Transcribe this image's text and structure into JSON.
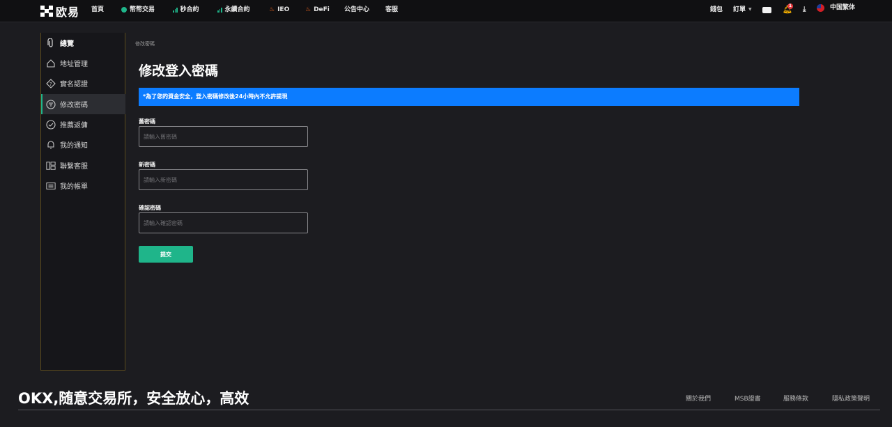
{
  "brand": {
    "logo_text": "欧易"
  },
  "nav": {
    "items": [
      {
        "label": "首頁"
      },
      {
        "label": "幣幣交易"
      },
      {
        "label": "秒合約"
      },
      {
        "label": "永續合約"
      },
      {
        "label": "IEO"
      },
      {
        "label": "DeFi"
      },
      {
        "label": "公告中心"
      },
      {
        "label": "客服"
      }
    ],
    "wallet": "錢包",
    "orders": "訂單",
    "notification_count": "1",
    "language": "中国繁体"
  },
  "sidebar": {
    "items": [
      {
        "label": "總覽",
        "icon": "paperclip-icon"
      },
      {
        "label": "地址管理",
        "icon": "home-icon"
      },
      {
        "label": "實名認證",
        "icon": "question-diamond-icon"
      },
      {
        "label": "修改密碼",
        "icon": "filter-icon"
      },
      {
        "label": "推薦返傭",
        "icon": "check-circle-icon"
      },
      {
        "label": "我的通知",
        "icon": "bell-icon"
      },
      {
        "label": "聯繫客服",
        "icon": "layout-icon"
      },
      {
        "label": "我的帳單",
        "icon": "list-icon"
      }
    ],
    "active_index": 3
  },
  "main": {
    "breadcrumb": "修改密碼",
    "title": "修改登入密碼",
    "banner": "*為了您的資金安全，登入密碼修改後24小時內不允許提現",
    "fields": [
      {
        "label": "舊密碼",
        "placeholder": "請輸入舊密碼"
      },
      {
        "label": "新密碼",
        "placeholder": "請輸入新密碼"
      },
      {
        "label": "確認密碼",
        "placeholder": "請輸入確認密碼"
      }
    ],
    "submit_label": "提交"
  },
  "footer": {
    "slogan": "OKX,随意交易所，安全放心，高效",
    "links": [
      "關於我們",
      "MSB證書",
      "服務條款",
      "隱私政策聲明"
    ]
  },
  "colors": {
    "accent": "#1fb58a",
    "banner": "#0c7cff",
    "background": "#1c1c20",
    "badge": "#e5393f"
  }
}
